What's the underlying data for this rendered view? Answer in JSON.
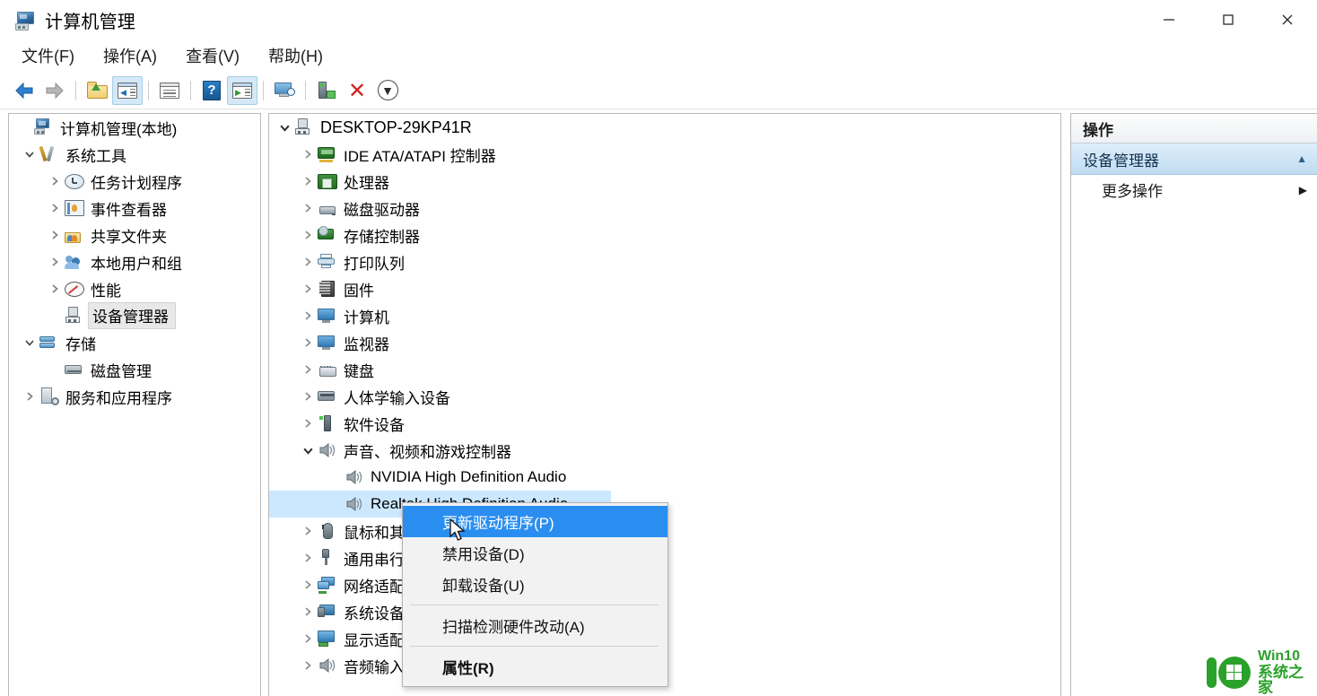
{
  "window": {
    "title": "计算机管理",
    "title_icon": "computer-management-icon",
    "controls": {
      "minimize": "—",
      "maximize": "□",
      "close": "✕"
    }
  },
  "menubar": [
    {
      "label": "文件(F)",
      "name": "menu-file"
    },
    {
      "label": "操作(A)",
      "name": "menu-action"
    },
    {
      "label": "查看(V)",
      "name": "menu-view"
    },
    {
      "label": "帮助(H)",
      "name": "menu-help"
    }
  ],
  "toolbar": [
    {
      "name": "back-button",
      "icon": "back-arrow-icon",
      "active": false
    },
    {
      "name": "forward-button",
      "icon": "forward-arrow-icon",
      "active": false
    },
    {
      "name": "up-one-level-button",
      "icon": "up-folder-icon",
      "active": false
    },
    {
      "name": "show-hide-console-tree-button",
      "icon": "show-tree-icon",
      "active": true
    },
    {
      "name": "properties-button",
      "icon": "properties-window-icon",
      "active": false
    },
    {
      "name": "help-button",
      "icon": "help-question-icon",
      "active": false
    },
    {
      "name": "show-hide-action-pane-button",
      "icon": "show-action-pane-icon",
      "active": true
    },
    {
      "name": "refresh-view-button",
      "icon": "monitor-magnifier-icon",
      "active": false
    },
    {
      "name": "update-driver-button",
      "icon": "device-plug-icon",
      "active": false
    },
    {
      "name": "uninstall-device-button",
      "icon": "red-x-icon",
      "active": false
    },
    {
      "name": "scan-hardware-button",
      "icon": "download-circle-icon",
      "active": false
    }
  ],
  "sidebar": {
    "items": [
      {
        "label": "计算机管理(本地)",
        "indent": 0,
        "twisty": "none",
        "icon": "computer-management-icon",
        "selected": false
      },
      {
        "label": "系统工具",
        "indent": 1,
        "twisty": "expanded",
        "icon": "tools-icon",
        "selected": false
      },
      {
        "label": "任务计划程序",
        "indent": 2,
        "twisty": "collapsed",
        "icon": "clock-icon",
        "selected": false
      },
      {
        "label": "事件查看器",
        "indent": 2,
        "twisty": "collapsed",
        "icon": "event-log-book-icon",
        "selected": false
      },
      {
        "label": "共享文件夹",
        "indent": 2,
        "twisty": "collapsed",
        "icon": "shared-folder-icon",
        "selected": false
      },
      {
        "label": "本地用户和组",
        "indent": 2,
        "twisty": "collapsed",
        "icon": "users-group-icon",
        "selected": false
      },
      {
        "label": "性能",
        "indent": 2,
        "twisty": "collapsed",
        "icon": "performance-icon",
        "selected": false
      },
      {
        "label": "设备管理器",
        "indent": 2,
        "twisty": "none",
        "icon": "device-manager-icon",
        "selected": true
      },
      {
        "label": "存储",
        "indent": 1,
        "twisty": "expanded",
        "icon": "storage-icon",
        "selected": false
      },
      {
        "label": "磁盘管理",
        "indent": 2,
        "twisty": "none",
        "icon": "disk-management-icon",
        "selected": false
      },
      {
        "label": "服务和应用程序",
        "indent": 1,
        "twisty": "collapsed",
        "icon": "services-apps-icon",
        "selected": false
      }
    ]
  },
  "device_tree": {
    "root": "DESKTOP-29KP41R",
    "items": [
      {
        "label": "DESKTOP-29KP41R",
        "indent": 0,
        "twisty": "expanded",
        "icon": "computer-node-icon",
        "selected": false
      },
      {
        "label": "IDE ATA/ATAPI 控制器",
        "indent": 1,
        "twisty": "collapsed",
        "icon": "ide-controller-icon",
        "selected": false
      },
      {
        "label": "处理器",
        "indent": 1,
        "twisty": "collapsed",
        "icon": "cpu-icon",
        "selected": false
      },
      {
        "label": "磁盘驱动器",
        "indent": 1,
        "twisty": "collapsed",
        "icon": "disk-drive-icon",
        "selected": false
      },
      {
        "label": "存储控制器",
        "indent": 1,
        "twisty": "collapsed",
        "icon": "storage-controller-icon",
        "selected": false
      },
      {
        "label": "打印队列",
        "indent": 1,
        "twisty": "collapsed",
        "icon": "printer-icon",
        "selected": false
      },
      {
        "label": "固件",
        "indent": 1,
        "twisty": "collapsed",
        "icon": "firmware-icon",
        "selected": false
      },
      {
        "label": "计算机",
        "indent": 1,
        "twisty": "collapsed",
        "icon": "computer-icon",
        "selected": false
      },
      {
        "label": "监视器",
        "indent": 1,
        "twisty": "collapsed",
        "icon": "monitor-icon",
        "selected": false
      },
      {
        "label": "键盘",
        "indent": 1,
        "twisty": "collapsed",
        "icon": "keyboard-icon",
        "selected": false
      },
      {
        "label": "人体学输入设备",
        "indent": 1,
        "twisty": "collapsed",
        "icon": "hid-icon",
        "selected": false
      },
      {
        "label": "软件设备",
        "indent": 1,
        "twisty": "collapsed",
        "icon": "software-device-icon",
        "selected": false
      },
      {
        "label": "声音、视频和游戏控制器",
        "indent": 1,
        "twisty": "expanded",
        "icon": "speaker-icon",
        "selected": false
      },
      {
        "label": "NVIDIA High Definition Audio",
        "indent": 2,
        "twisty": "none",
        "icon": "speaker-icon",
        "selected": false
      },
      {
        "label": "Realtek High Definition Audio",
        "indent": 2,
        "twisty": "none",
        "icon": "speaker-icon",
        "selected": true
      },
      {
        "label": "鼠标和其他指针设备",
        "indent": 1,
        "twisty": "collapsed",
        "icon": "mouse-icon",
        "selected": false
      },
      {
        "label": "通用串行总线控制器",
        "indent": 1,
        "twisty": "collapsed",
        "icon": "usb-icon",
        "selected": false
      },
      {
        "label": "网络适配器",
        "indent": 1,
        "twisty": "collapsed",
        "icon": "network-adapter-icon",
        "selected": false
      },
      {
        "label": "系统设备",
        "indent": 1,
        "twisty": "collapsed",
        "icon": "system-device-icon",
        "selected": false
      },
      {
        "label": "显示适配器",
        "indent": 1,
        "twisty": "collapsed",
        "icon": "display-adapter-icon",
        "selected": false
      },
      {
        "label": "音频输入和输出",
        "indent": 1,
        "twisty": "collapsed",
        "icon": "speaker-icon",
        "selected": false
      }
    ]
  },
  "action_pane": {
    "header": "操作",
    "section": "设备管理器",
    "section_chevron": "▲",
    "items": [
      {
        "label": "更多操作",
        "chevron": "▶"
      }
    ]
  },
  "context_menu": {
    "items": [
      {
        "label": "更新驱动程序(P)",
        "type": "item",
        "highlighted": true,
        "bold": false
      },
      {
        "label": "禁用设备(D)",
        "type": "item",
        "highlighted": false,
        "bold": false
      },
      {
        "label": "卸载设备(U)",
        "type": "item",
        "highlighted": false,
        "bold": false
      },
      {
        "type": "separator"
      },
      {
        "label": "扫描检测硬件改动(A)",
        "type": "item",
        "highlighted": false,
        "bold": false
      },
      {
        "type": "separator"
      },
      {
        "label": "属性(R)",
        "type": "item",
        "highlighted": false,
        "bold": true
      }
    ]
  },
  "watermark": {
    "line1": "Win10",
    "line2": "系统之家"
  },
  "colors": {
    "selection_blue": "#cce8ff",
    "menu_highlight": "#2a8ef0",
    "action_section": "#bfdcf2",
    "watermark_green": "#2aa12a"
  }
}
